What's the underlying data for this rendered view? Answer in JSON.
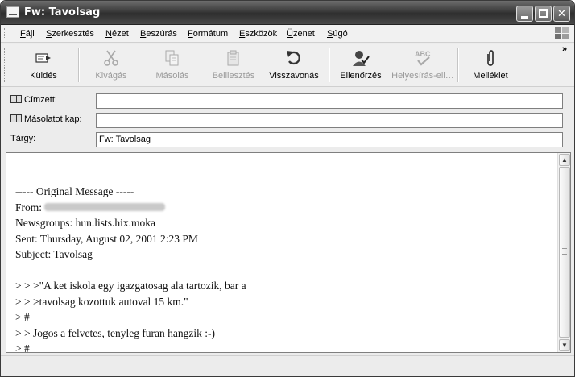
{
  "window": {
    "title": "Fw: Tavolsag",
    "minimize": "_",
    "close": "✕"
  },
  "menu": {
    "items": [
      "Fájl",
      "Szerkesztés",
      "Nézet",
      "Beszúrás",
      "Formátum",
      "Eszközök",
      "Üzenet",
      "Súgó"
    ]
  },
  "toolbar": {
    "send": "Küldés",
    "cut": "Kivágás",
    "copy": "Másolás",
    "paste": "Beillesztés",
    "undo": "Visszavonás",
    "check": "Ellenőrzés",
    "spelling": "Helyesírás-ell…",
    "spelling_icon_text": "ABC",
    "attach": "Melléklet",
    "overflow": "»"
  },
  "fields": {
    "to_label": "Címzett:",
    "to_value": "",
    "cc_label": "Másolatot kap:",
    "cc_value": "",
    "subject_label": "Tárgy:",
    "subject_value": "Fw: Tavolsag"
  },
  "message": {
    "lines": [
      "----- Original Message -----",
      "From: ",
      "Newsgroups: hun.lists.hix.moka",
      "Sent: Thursday, August 02, 2001 2:23 PM",
      "Subject: Tavolsag",
      "",
      "> > >\"A ket iskola egy igazgatosag ala tartozik, bar a",
      "> > >tavolsag kozottuk autoval 15 km.\"",
      "> #",
      "> > Jogos a felvetes, tenyleg furan hangzik :-)",
      "> #"
    ]
  },
  "scrollbar": {
    "up": "▲",
    "down": "▼"
  },
  "colors": {
    "titlebar": "#3b3b3b",
    "chrome": "#ececec"
  }
}
